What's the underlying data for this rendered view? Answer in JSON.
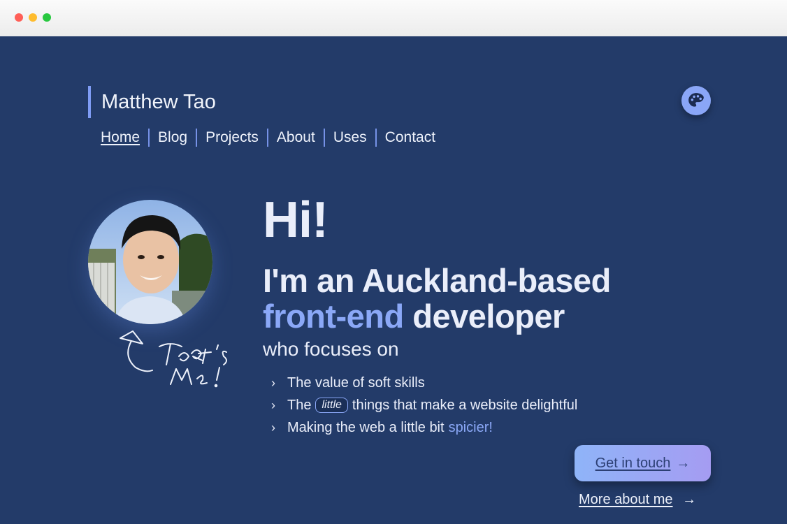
{
  "site": {
    "brand": "Matthew Tao"
  },
  "nav": [
    {
      "label": "Home",
      "active": true
    },
    {
      "label": "Blog"
    },
    {
      "label": "Projects"
    },
    {
      "label": "About"
    },
    {
      "label": "Uses"
    },
    {
      "label": "Contact"
    }
  ],
  "hero": {
    "greeting": "Hi!",
    "headline_line1": "I'm an Auckland-based",
    "headline_accent": "front-end",
    "headline_rest": "developer",
    "subhead": "who focuses on",
    "focus": {
      "item1": "The value of soft skills",
      "item2_pre": "The",
      "item2_pill": "little",
      "item2_post": "things that make a website delightful",
      "item3_pre": "Making the web a little bit",
      "item3_accent": "spicier!"
    },
    "annotation": "That's Me!"
  },
  "cta": {
    "primary": "Get in touch",
    "secondary": "More about me",
    "arrow": "→"
  },
  "icons": {
    "theme_toggle": "palette-icon",
    "bullet": "chevron-right-icon"
  },
  "colors": {
    "background": "#233b69",
    "accent": "#8ba8f7",
    "text": "#eaeefa"
  }
}
